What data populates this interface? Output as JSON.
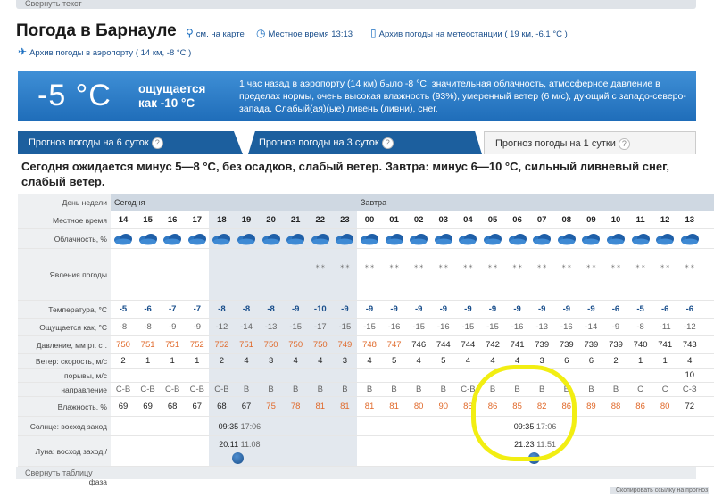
{
  "top_link": "Свернуть текст",
  "title": "Погода в Барнауле",
  "links": {
    "map": "см. на карте",
    "local_time": "Местное время 13:13",
    "station_archive": "Архив погоды на метеостанции ( 19 км, -6.1 °C )",
    "airport_archive": "Архив погоды в аэропорту ( 14 км, -8 °C )"
  },
  "current": {
    "temp": "-5 °C",
    "feels_line1": "ощущается",
    "feels_line2": "как -10 °C",
    "description": "1 час назад в аэропорту (14 км) было -8 °C, значительная облачность, атмосферное давление в пределах нормы, очень высокая влажность (93%), умеренный ветер (6 м/с), дующий с западо-северо-запада. Слабый(ая)(ые) ливень (ливни), снег."
  },
  "tabs": [
    "Прогноз погоды на 6 суток",
    "Прогноз погоды на 3 суток",
    "Прогноз погоды на 1 сутки"
  ],
  "summary": "Сегодня ожидается минус 5—8 °C, без осадков, слабый ветер. Завтра: минус 6—10 °C, сильный ливневый снег, слабый ветер.",
  "labels": {
    "day": "День недели",
    "today": "Сегодня",
    "tomorrow": "Завтра",
    "time": "Местное время",
    "cloud": "Облачность, %",
    "phenomena": "Явления погоды",
    "temp": "Температура, °C",
    "feels": "Ощущается как, °C",
    "pressure": "Давление, мм рт. ст.",
    "wind_speed": "Ветер: скорость, м/с",
    "gusts": "порывы, м/с",
    "direction": "направление",
    "humidity": "Влажность, %",
    "sun": "Солнце: восход заход",
    "moon": "Луна: восход заход",
    "phase": "фаза"
  },
  "hours": [
    "14",
    "15",
    "16",
    "17",
    "18",
    "19",
    "20",
    "21",
    "22",
    "23",
    "00",
    "01",
    "02",
    "03",
    "04",
    "05",
    "06",
    "07",
    "08",
    "09",
    "10",
    "11",
    "12",
    "13"
  ],
  "temp": [
    "-5",
    "-6",
    "-7",
    "-7",
    "-8",
    "-8",
    "-8",
    "-9",
    "-10",
    "-9",
    "-9",
    "-9",
    "-9",
    "-9",
    "-9",
    "-9",
    "-9",
    "-9",
    "-9",
    "-9",
    "-6",
    "-5",
    "-6",
    "-6"
  ],
  "feels": [
    "-8",
    "-8",
    "-9",
    "-9",
    "-12",
    "-14",
    "-13",
    "-15",
    "-17",
    "-15",
    "-15",
    "-16",
    "-15",
    "-16",
    "-15",
    "-15",
    "-16",
    "-13",
    "-16",
    "-14",
    "-9",
    "-8",
    "-11",
    "-12"
  ],
  "pressure": [
    "750",
    "751",
    "751",
    "752",
    "752",
    "751",
    "750",
    "750",
    "750",
    "749",
    "748",
    "747",
    "746",
    "744",
    "744",
    "742",
    "741",
    "739",
    "739",
    "739",
    "739",
    "740",
    "741",
    "743"
  ],
  "wind_speed": [
    "2",
    "1",
    "1",
    "1",
    "2",
    "4",
    "3",
    "4",
    "4",
    "3",
    "4",
    "5",
    "4",
    "5",
    "4",
    "4",
    "4",
    "3",
    "6",
    "6",
    "2",
    "1",
    "1",
    "4"
  ],
  "gusts": [
    "",
    "",
    "",
    "",
    "",
    "",
    "",
    "",
    "",
    "",
    "",
    "",
    "",
    "",
    "",
    "",
    "",
    "",
    "",
    "",
    "",
    "",
    "",
    "10"
  ],
  "direction": [
    "С-В",
    "С-В",
    "С-В",
    "С-В",
    "С-В",
    "В",
    "В",
    "В",
    "В",
    "В",
    "В",
    "В",
    "В",
    "В",
    "С-В",
    "В",
    "В",
    "В",
    "В",
    "В",
    "В",
    "С",
    "С",
    "С-З"
  ],
  "humidity": [
    "69",
    "69",
    "68",
    "67",
    "68",
    "67",
    "75",
    "78",
    "81",
    "81",
    "81",
    "81",
    "80",
    "90",
    "86",
    "86",
    "85",
    "82",
    "86",
    "89",
    "88",
    "86",
    "80",
    "72"
  ],
  "sun_today": [
    "09:35",
    "17:06"
  ],
  "sun_tomorrow": [
    "09:35",
    "17:06"
  ],
  "moon_today": [
    "20:11",
    "11:08"
  ],
  "moon_tomorrow": [
    "21:23",
    "11:51"
  ],
  "bottom_link": "Свернуть таблицу",
  "corner_text": "Скопировать ссылку на прогноз",
  "colors": {
    "header_blue": "#1f6db9",
    "tab_blue": "#1c5f9e",
    "highlight": "#f2ee12",
    "orange": "#e0692a"
  }
}
